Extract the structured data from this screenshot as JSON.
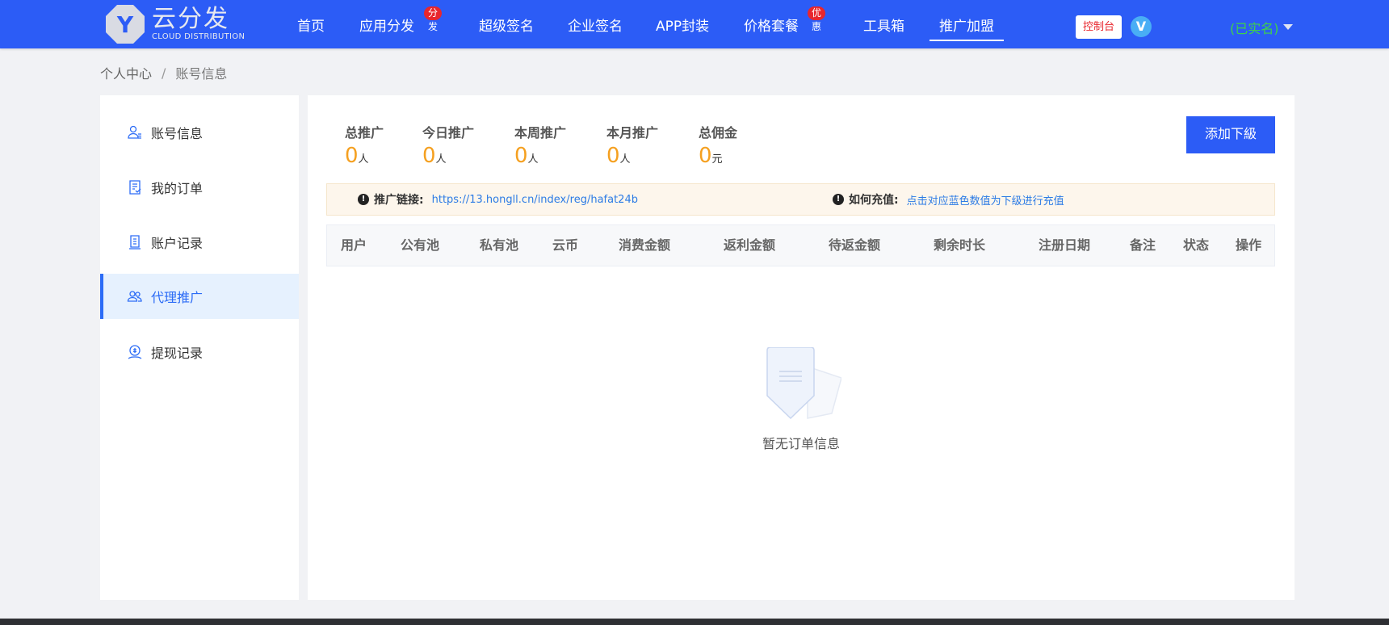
{
  "logo": {
    "mark": "Y",
    "name": "云分发",
    "subtitle": "CLOUD DISTRIBUTION"
  },
  "nav": {
    "items": [
      {
        "label": "首页"
      },
      {
        "label": "应用分发",
        "badge": "分发"
      },
      {
        "label": "超级签名"
      },
      {
        "label": "企业签名"
      },
      {
        "label": "APP封装"
      },
      {
        "label": "价格套餐",
        "badge": "优惠"
      },
      {
        "label": "工具箱"
      },
      {
        "label": "推广加盟",
        "active": true
      }
    ],
    "console_label": "控制台",
    "vip_mark": "V",
    "user_status": "(已实名)"
  },
  "breadcrumb": {
    "root": "个人中心",
    "separator": "/",
    "current": "账号信息"
  },
  "sidebar": {
    "items": [
      {
        "label": "账号信息",
        "icon": "user-icon"
      },
      {
        "label": "我的订单",
        "icon": "order-icon"
      },
      {
        "label": "账户记录",
        "icon": "record-icon"
      },
      {
        "label": "代理推广",
        "icon": "group-icon",
        "active": true
      },
      {
        "label": "提现记录",
        "icon": "withdraw-icon"
      }
    ]
  },
  "stats": [
    {
      "label": "总推广",
      "value": "0",
      "unit": "人"
    },
    {
      "label": "今日推广",
      "value": "0",
      "unit": "人"
    },
    {
      "label": "本周推广",
      "value": "0",
      "unit": "人"
    },
    {
      "label": "本月推广",
      "value": "0",
      "unit": "人"
    },
    {
      "label": "总佣金",
      "value": "0",
      "unit": "元"
    }
  ],
  "add_button": "添加下級",
  "notice": {
    "link_label": "推广链接:",
    "link_url": "https://13.hongll.cn/index/reg/hafat24b",
    "recharge_label": "如何充值:",
    "recharge_text": "点击对应蓝色数值为下级进行充值"
  },
  "table": {
    "columns": [
      "用户",
      "公有池",
      "私有池",
      "云币",
      "消费金额",
      "返利金额",
      "待返金额",
      "剩余时长",
      "注册日期",
      "备注",
      "状态",
      "操作"
    ]
  },
  "empty_text": "暂无订单信息",
  "colors": {
    "primary": "#2c5cf6",
    "accent": "#f5a020",
    "badge": "#e8262d",
    "verified": "#3fd24a",
    "active_bg": "#e6f1fe"
  }
}
